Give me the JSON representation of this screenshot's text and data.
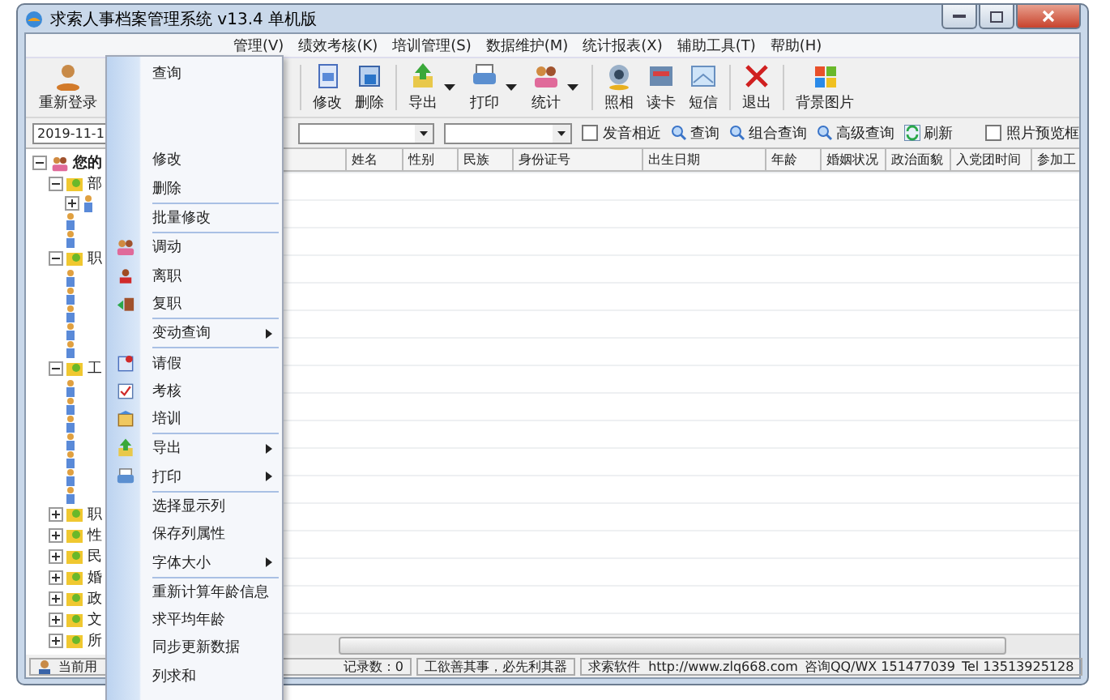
{
  "window": {
    "title": "求索人事档案管理系统 v13.4 单机版"
  },
  "menu_bar": [
    "管理(V)",
    "绩效考核(K)",
    "培训管理(S)",
    "数据维护(M)",
    "统计报表(X)",
    "辅助工具(T)",
    "帮助(H)"
  ],
  "toolbar": [
    {
      "label": "重新登录",
      "dropdown": false
    },
    {
      "label": "修改",
      "dropdown": false
    },
    {
      "label": "删除",
      "dropdown": false
    },
    {
      "label": "导出",
      "dropdown": true
    },
    {
      "label": "打印",
      "dropdown": true
    },
    {
      "label": "统计",
      "dropdown": true
    },
    {
      "label": "照相",
      "dropdown": false
    },
    {
      "label": "读卡",
      "dropdown": false
    },
    {
      "label": "短信",
      "dropdown": false
    },
    {
      "label": "退出",
      "dropdown": false
    },
    {
      "label": "背景图片",
      "dropdown": false
    }
  ],
  "filter_bar": {
    "date": "2019-11-1",
    "items": [
      {
        "kind": "checkbox",
        "label": "发音相近",
        "checked": false
      },
      {
        "kind": "search",
        "label": "查询"
      },
      {
        "kind": "search",
        "label": "组合查询"
      },
      {
        "kind": "search",
        "label": "高级查询"
      },
      {
        "kind": "refresh",
        "label": "刷新"
      },
      {
        "kind": "checkbox",
        "label": "照片预览框",
        "checked": false
      }
    ]
  },
  "tree": {
    "label": "您的",
    "expanded": true,
    "children": [
      {
        "label": "部",
        "expanded": true,
        "children": [
          {
            "kind": "leaf",
            "expanded": false
          },
          {
            "kind": "leaf"
          },
          {
            "kind": "leaf"
          }
        ]
      },
      {
        "label": "职",
        "expanded": true,
        "children": [
          {
            "kind": "leaf"
          },
          {
            "kind": "leaf"
          },
          {
            "kind": "leaf"
          },
          {
            "kind": "leaf"
          },
          {
            "kind": "leaf"
          }
        ]
      },
      {
        "label": "工",
        "expanded": true,
        "children": [
          {
            "kind": "leaf"
          },
          {
            "kind": "leaf"
          },
          {
            "kind": "leaf"
          },
          {
            "kind": "leaf"
          },
          {
            "kind": "leaf"
          },
          {
            "kind": "leaf"
          },
          {
            "kind": "leaf"
          }
        ]
      },
      {
        "label": "职",
        "expanded": false
      },
      {
        "label": "性",
        "expanded": false
      },
      {
        "label": "民",
        "expanded": false
      },
      {
        "label": "婚",
        "expanded": false
      },
      {
        "label": "政",
        "expanded": false
      },
      {
        "label": "文",
        "expanded": false
      },
      {
        "label": "所",
        "expanded": false
      }
    ]
  },
  "grid": {
    "columns": [
      "姓名",
      "性别",
      "民族",
      "身份证号",
      "出生日期",
      "年龄",
      "婚姻状况",
      "政治面貌",
      "入党团时间",
      "参加工"
    ]
  },
  "context_menu": [
    {
      "kind": "item",
      "label": "查询",
      "submenu": false
    },
    {
      "kind": "gap"
    },
    {
      "kind": "item",
      "label": "修改",
      "submenu": false
    },
    {
      "kind": "item",
      "label": "删除",
      "submenu": false
    },
    {
      "kind": "separator"
    },
    {
      "kind": "item",
      "label": "批量修改",
      "submenu": false
    },
    {
      "kind": "separator"
    },
    {
      "kind": "item",
      "label": "调动",
      "submenu": false
    },
    {
      "kind": "item",
      "label": "离职",
      "submenu": false
    },
    {
      "kind": "item",
      "label": "复职",
      "submenu": false
    },
    {
      "kind": "separator"
    },
    {
      "kind": "item",
      "label": "变动查询",
      "submenu": true
    },
    {
      "kind": "separator"
    },
    {
      "kind": "item",
      "label": "请假",
      "submenu": false
    },
    {
      "kind": "item",
      "label": "考核",
      "submenu": false
    },
    {
      "kind": "item",
      "label": "培训",
      "submenu": false
    },
    {
      "kind": "separator"
    },
    {
      "kind": "item",
      "label": "导出",
      "submenu": true
    },
    {
      "kind": "item",
      "label": "打印",
      "submenu": true
    },
    {
      "kind": "separator"
    },
    {
      "kind": "item",
      "label": "选择显示列",
      "submenu": false
    },
    {
      "kind": "item",
      "label": "保存列属性",
      "submenu": false
    },
    {
      "kind": "item",
      "label": "字体大小",
      "submenu": true
    },
    {
      "kind": "separator"
    },
    {
      "kind": "item",
      "label": "重新计算年龄信息",
      "submenu": false
    },
    {
      "kind": "item",
      "label": "求平均年龄",
      "submenu": false
    },
    {
      "kind": "item",
      "label": "同步更新数据",
      "submenu": false
    },
    {
      "kind": "item",
      "label": "列求和",
      "submenu": false
    }
  ],
  "status_bar": [
    "当前用",
    "记录数：0",
    "工欲善其事，必先利其器",
    "求索软件  http://www.zlq668.com",
    "咨询QQ/WX 151477039",
    "Tel 13513925128"
  ]
}
